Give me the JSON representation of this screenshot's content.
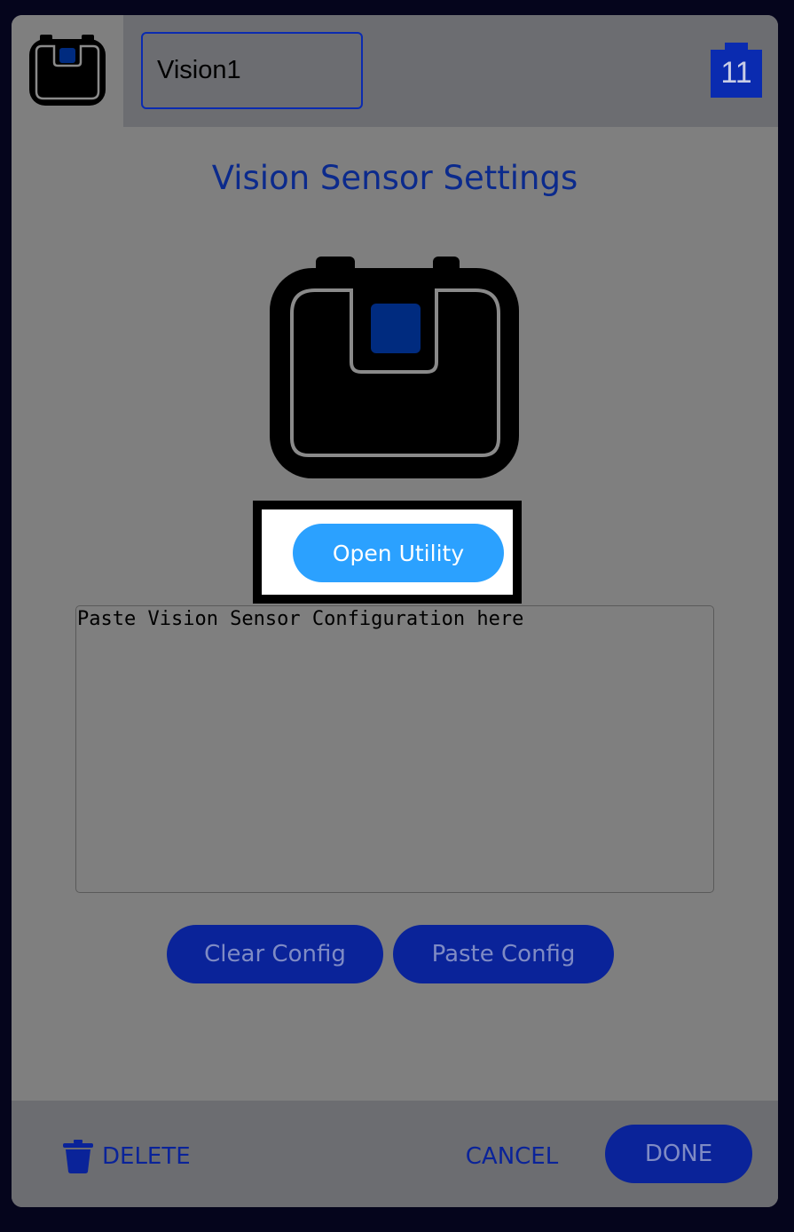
{
  "header": {
    "device_name": "Vision1",
    "port_number": "11",
    "device_icon": "vision-sensor-icon",
    "port_icon": "port-badge-icon"
  },
  "main": {
    "title": "Vision Sensor Settings",
    "sensor_image": "vision-sensor-icon",
    "open_utility_label": "Open Utility",
    "config_placeholder": "Paste Vision Sensor Configuration here",
    "config_value": "",
    "clear_config_label": "Clear Config",
    "paste_config_label": "Paste Config"
  },
  "footer": {
    "delete_label": "DELETE",
    "delete_icon": "trash-icon",
    "cancel_label": "CANCEL",
    "done_label": "DONE"
  },
  "colors": {
    "page_background": "#05051c",
    "panel_background": "#7f7f7f",
    "bar_background": "#6c6d71",
    "accent_blue": "#0a2399",
    "title_blue": "#0b2a8c",
    "utility_button": "#2ba1ff",
    "highlight_border": "#000000"
  }
}
